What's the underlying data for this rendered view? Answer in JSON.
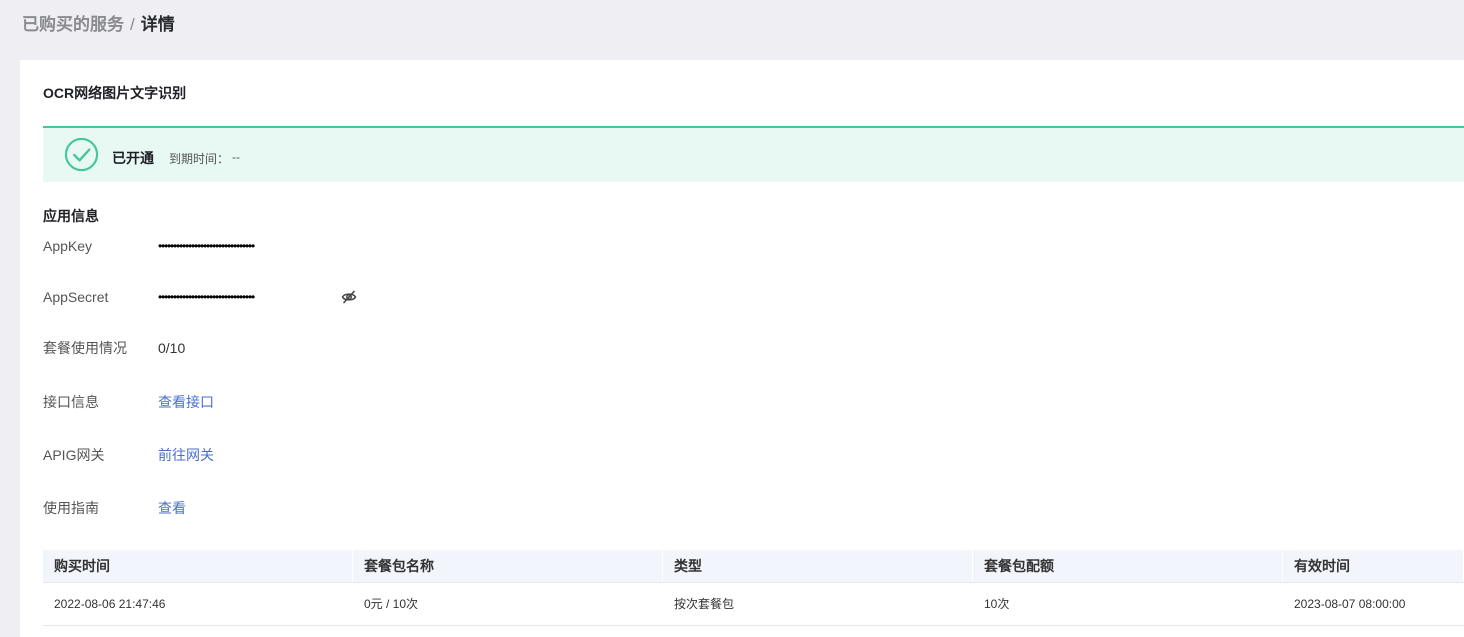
{
  "breadcrumb": {
    "parent": "已购买的服务",
    "separator": "/",
    "current": "详情"
  },
  "product": {
    "title": "OCR网络图片文字识别"
  },
  "status": {
    "icon": "check-circle-icon",
    "color": "#42c69b",
    "label": "已开通",
    "expire_label": "到期时间：",
    "expire_value": "--"
  },
  "app_info": {
    "section_title": "应用信息",
    "appkey_label": "AppKey",
    "appkey_value": "••••••••••••••••••••••••••••••••",
    "appsecret_label": "AppSecret",
    "appsecret_value": "••••••••••••••••••••••••••••••••",
    "usage_label": "套餐使用情况",
    "usage_value": "0/10",
    "api_label": "接口信息",
    "api_link": "查看接口",
    "gateway_label": "APIG网关",
    "gateway_link": "前往网关",
    "guide_label": "使用指南",
    "guide_link": "查看"
  },
  "table": {
    "headers": [
      "购买时间",
      "套餐包名称",
      "类型",
      "套餐包配额",
      "有效时间"
    ],
    "rows": [
      [
        "2022-08-06 21:47:46",
        "0元 / 10次",
        "按次套餐包",
        "10次",
        "2023-08-07 08:00:00"
      ]
    ]
  }
}
